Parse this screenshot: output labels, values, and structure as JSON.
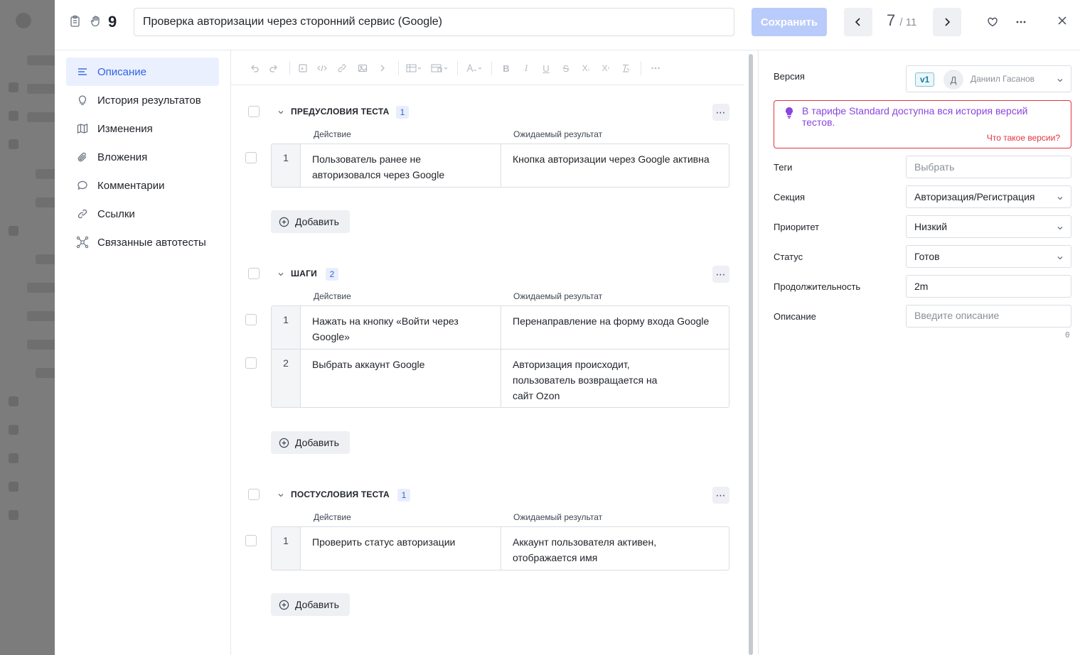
{
  "header": {
    "case_id": "9",
    "title": "Проверка авторизации через сторонний сервис (Google)",
    "save_label": "Сохранить",
    "pager_current": "7",
    "pager_total": "/ 11"
  },
  "nav": {
    "items": [
      {
        "label": "Описание",
        "icon": "list-icon"
      },
      {
        "label": "История результатов",
        "icon": "lightbulb-icon"
      },
      {
        "label": "Изменения",
        "icon": "book-icon"
      },
      {
        "label": "Вложения",
        "icon": "paperclip-icon"
      },
      {
        "label": "Комментарии",
        "icon": "comment-icon"
      },
      {
        "label": "Ссылки",
        "icon": "link-icon"
      },
      {
        "label": "Связанные автотесты",
        "icon": "network-icon"
      }
    ]
  },
  "columns": {
    "action": "Действие",
    "result": "Ожидаемый результат"
  },
  "add_label": "Добавить",
  "sections": {
    "pre": {
      "title": "ПРЕДУСЛОВИЯ ТЕСТА",
      "count": "1",
      "steps": [
        {
          "num": "1",
          "action": "Пользователь ранее не авторизовался через Google",
          "result": "Кнопка авторизации через Google активна"
        }
      ]
    },
    "steps": {
      "title": "ШАГИ",
      "count": "2",
      "steps": [
        {
          "num": "1",
          "action": "Нажать на кнопку «Войти через Google»",
          "result": "Перенаправление на форму входа Google"
        },
        {
          "num": "2",
          "action": "Выбрать аккаунт Google",
          "result": "Авторизация происходит, пользователь возвращается на сайт Ozon"
        }
      ]
    },
    "post": {
      "title": "ПОСТУСЛОВИЯ ТЕСТА",
      "count": "1",
      "steps": [
        {
          "num": "1",
          "action": "Проверить статус авторизации",
          "result": "Аккаунт пользователя активен, отображается имя"
        }
      ]
    }
  },
  "right": {
    "version_label": "Версия",
    "version_badge": "v1",
    "author_initial": "Д",
    "author_name": "Даниил Гасанов",
    "notice_text": "В тарифе Standard доступна вся история версий тестов.",
    "notice_link": "Что такое версии?",
    "tags_label": "Теги",
    "tags_placeholder": "Выбрать",
    "section_label": "Секция",
    "section_value": "Авторизация/Регистрация",
    "priority_label": "Приоритет",
    "priority_value": "Низкий",
    "status_label": "Статус",
    "status_value": "Готов",
    "duration_label": "Продолжительность",
    "duration_value": "2m",
    "description_label": "Описание",
    "description_placeholder": "Введите описание",
    "description_counter": "0"
  },
  "colors": {
    "accent": "#3362e3",
    "save_disabled": "#b9cbfa",
    "notice_border": "#e0343f",
    "notice_text": "#8b45e0"
  }
}
